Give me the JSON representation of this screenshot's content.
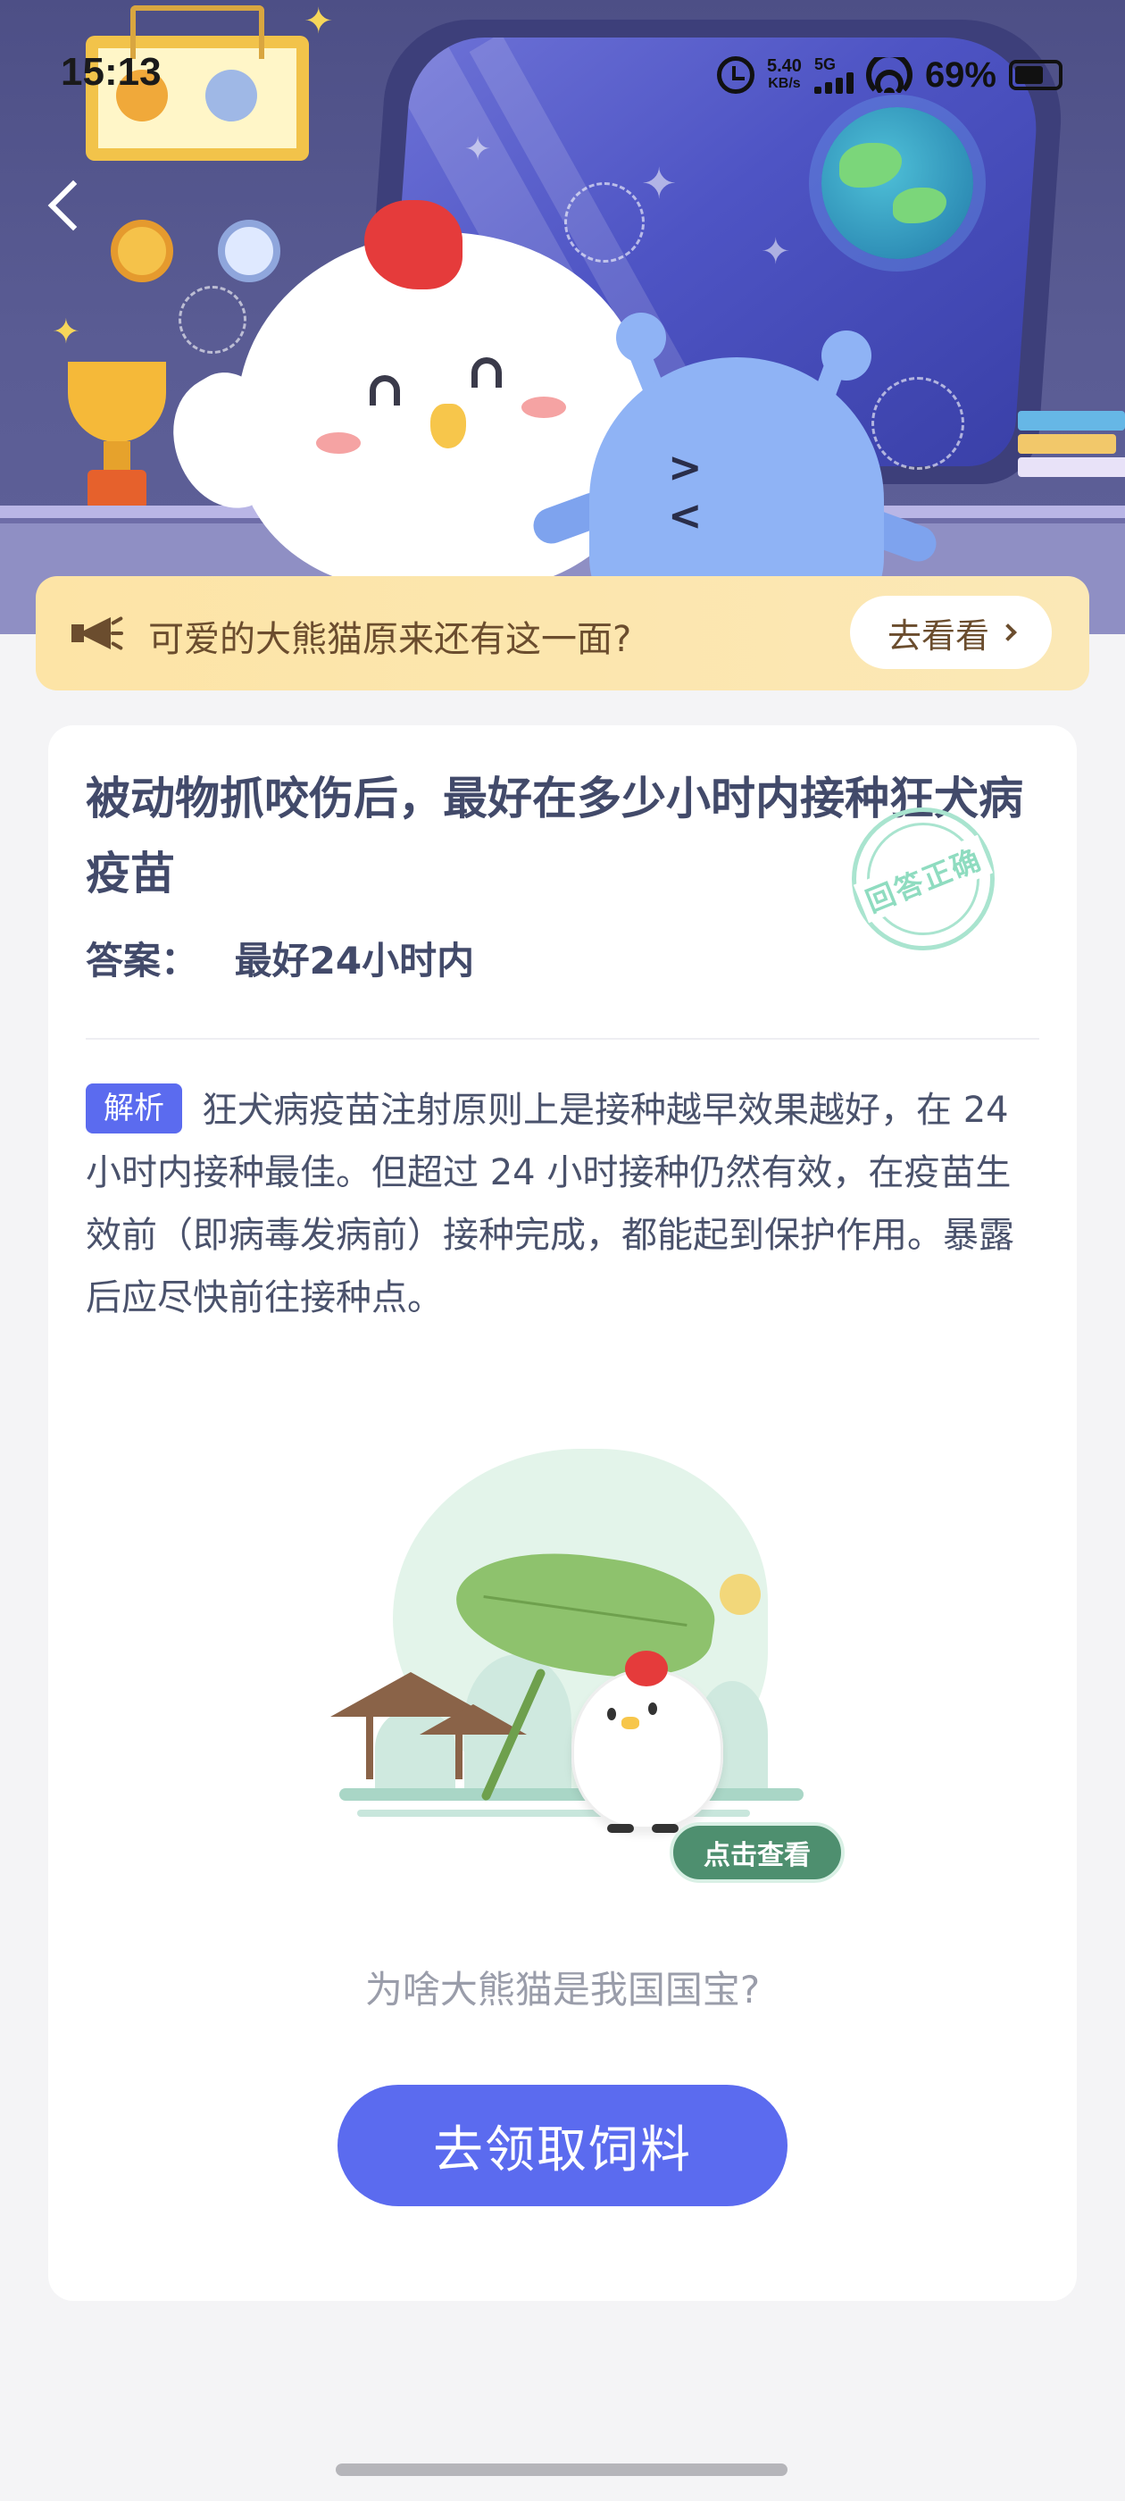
{
  "status_bar": {
    "time": "15:13",
    "net_speed_value": "5.40",
    "net_speed_unit": "KB/s",
    "network": "5G",
    "battery": "69%"
  },
  "banner": {
    "text": "可爱的大熊猫原来还有这一面?",
    "button_label": "去看看"
  },
  "question": {
    "title": "被动物抓咬伤后，最好在多少小时内接种狂犬病疫苗",
    "stamp": "回答正确",
    "answer_label": "答案：",
    "answer_value": "最好24小时内"
  },
  "analysis": {
    "tag": "解析",
    "text": "狂犬病疫苗注射原则上是接种越早效果越好，在 24 小时内接种最佳。但超过 24 小时接种仍然有效，在疫苗生效前（即病毒发病前）接种完成，都能起到保护作用。暴露后应尽快前往接种点。"
  },
  "promo": {
    "badge": "点击查看",
    "question_link": "为啥大熊猫是我国国宝?"
  },
  "cta": {
    "label": "去领取饲料"
  },
  "colors": {
    "accent": "#5b6bef",
    "banner_bg": "#fde4a6",
    "banner_text": "#6b4d2e",
    "title_text": "#424a6a",
    "stamp": "#a9e4cf",
    "badge_green": "#4e8f6f"
  },
  "icons": [
    "back-icon",
    "alarm-icon",
    "signal-icon",
    "wifi-icon",
    "battery-icon",
    "megaphone-icon",
    "chevron-right-icon"
  ]
}
